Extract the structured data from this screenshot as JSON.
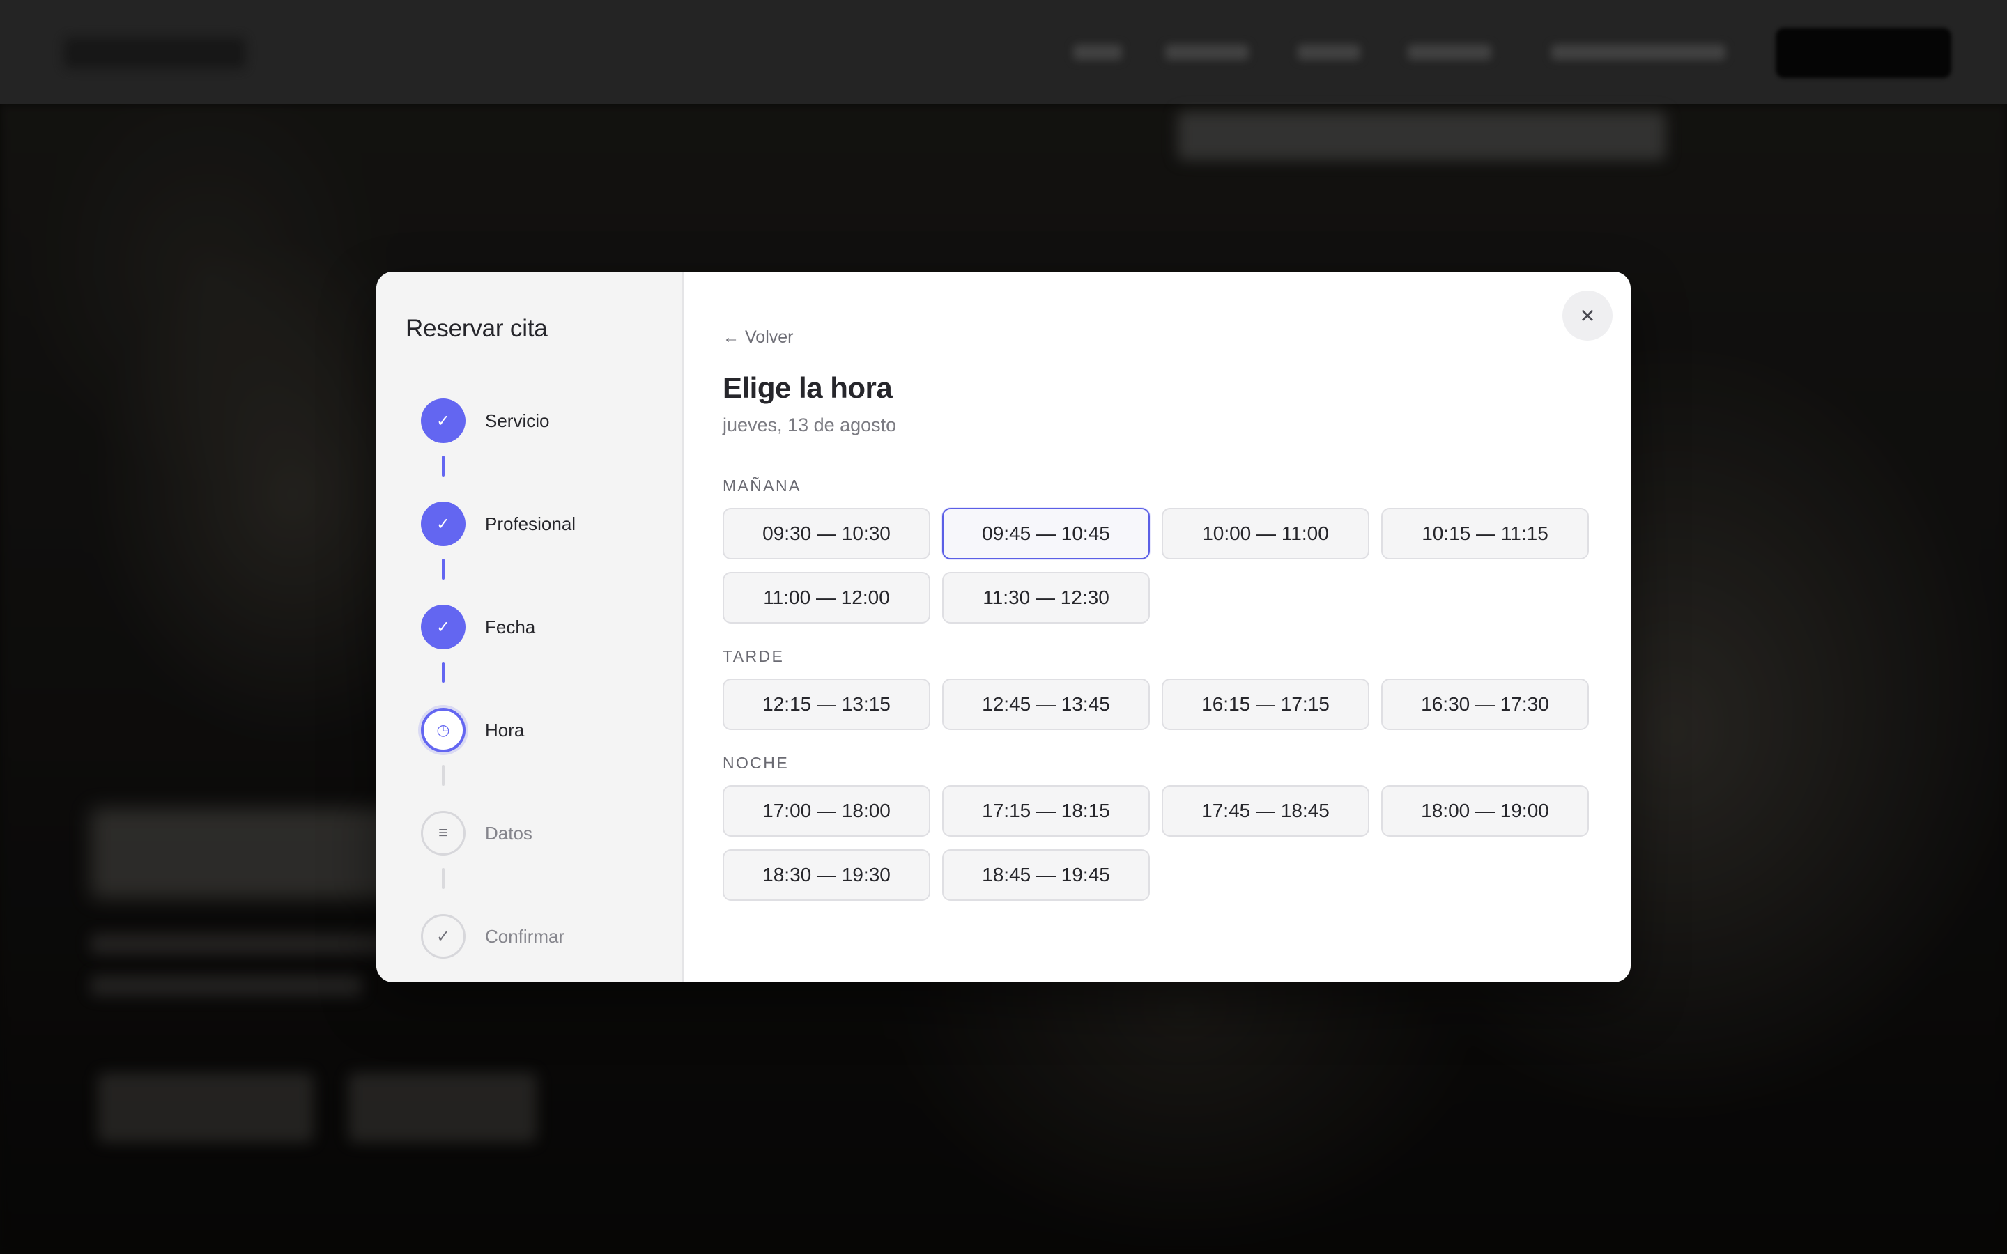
{
  "modal": {
    "sidebar_title": "Reservar cita",
    "steps": [
      {
        "label": "Servicio",
        "state": "done",
        "icon": "check-icon"
      },
      {
        "label": "Profesional",
        "state": "done",
        "icon": "check-icon"
      },
      {
        "label": "Fecha",
        "state": "done",
        "icon": "check-icon"
      },
      {
        "label": "Hora",
        "state": "current",
        "icon": "clock-icon"
      },
      {
        "label": "Datos",
        "state": "pending",
        "icon": "lines-icon"
      },
      {
        "label": "Confirmar",
        "state": "pending",
        "icon": "check-icon"
      }
    ],
    "back_label": "Volver",
    "heading": "Elige la hora",
    "date_label": "jueves, 13 de agosto",
    "sections": [
      {
        "title": "MAÑANA",
        "slots": [
          "09:30 — 10:30",
          "09:45 — 10:45",
          "10:00 — 11:00",
          "10:15 — 11:15",
          "11:00 — 12:00",
          "11:30 — 12:30"
        ]
      },
      {
        "title": "TARDE",
        "slots": [
          "12:15 — 13:15",
          "12:45 — 13:45",
          "16:15 — 17:15",
          "16:30 — 17:30"
        ]
      },
      {
        "title": "NOCHE",
        "slots": [
          "17:00 — 18:00",
          "17:15 — 18:15",
          "17:45 — 18:45",
          "18:00 — 19:00",
          "18:30 — 19:30",
          "18:45 — 19:45"
        ]
      }
    ],
    "selected_slot": "09:45 — 10:45"
  },
  "colors": {
    "accent": "#6366f1",
    "sidebar_bg": "#f4f4f4",
    "slot_bg": "#f5f5f6",
    "slot_border": "#dfdfe3"
  }
}
